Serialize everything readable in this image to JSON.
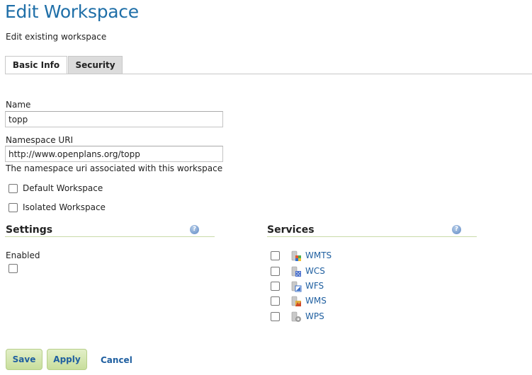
{
  "header": {
    "title": "Edit Workspace",
    "subtitle": "Edit existing workspace"
  },
  "tabs": [
    {
      "label": "Basic Info",
      "active": true
    },
    {
      "label": "Security",
      "active": false
    }
  ],
  "form": {
    "name": {
      "label": "Name",
      "value": "topp"
    },
    "namespace_uri": {
      "label": "Namespace URI",
      "value": "http://www.openplans.org/topp",
      "help": "The namespace uri associated with this workspace"
    },
    "default_workspace": {
      "label": "Default Workspace",
      "checked": false
    },
    "isolated_workspace": {
      "label": "Isolated Workspace",
      "checked": false
    }
  },
  "settings": {
    "title": "Settings",
    "help_icon": "help-icon",
    "enabled": {
      "label": "Enabled",
      "checked": false
    }
  },
  "services": {
    "title": "Services",
    "help_icon": "help-icon",
    "items": [
      {
        "label": "WMTS",
        "icon": "wmts-service-icon",
        "checked": false
      },
      {
        "label": "WCS",
        "icon": "wcs-service-icon",
        "checked": false
      },
      {
        "label": "WFS",
        "icon": "wfs-service-icon",
        "checked": false
      },
      {
        "label": "WMS",
        "icon": "wms-service-icon",
        "checked": false
      },
      {
        "label": "WPS",
        "icon": "wps-service-icon",
        "checked": false
      }
    ]
  },
  "actions": {
    "save_label": "Save",
    "apply_label": "Apply",
    "cancel_label": "Cancel"
  },
  "colors": {
    "title_blue": "#1f6fa8",
    "link_blue": "#1f5fa0",
    "button_green": "#c8de9c",
    "section_rule": "#c9dba8"
  }
}
